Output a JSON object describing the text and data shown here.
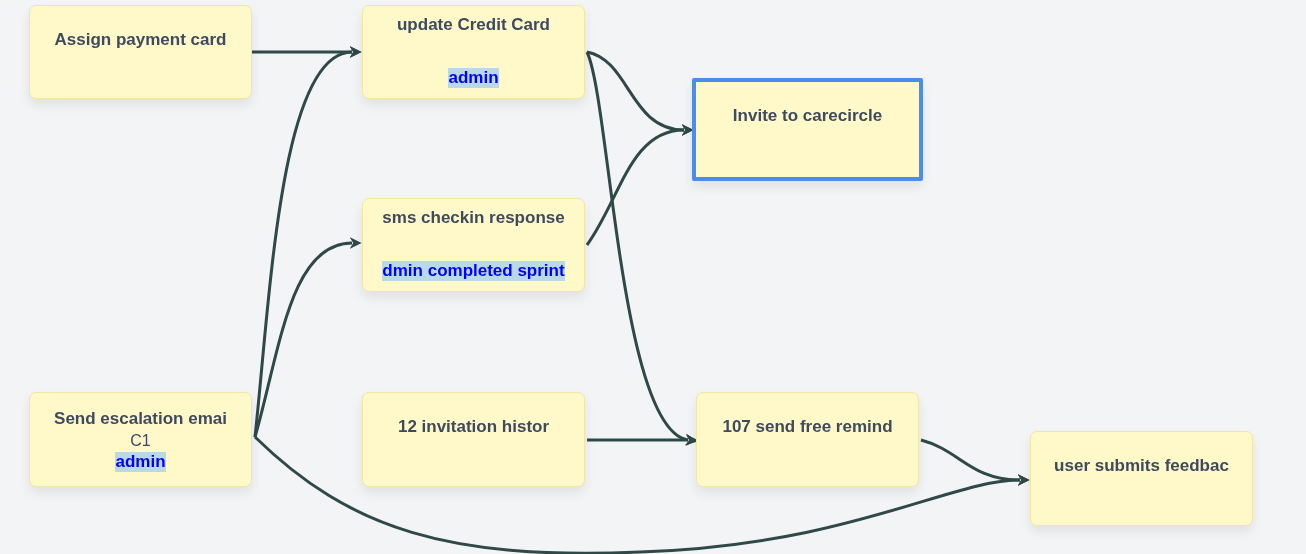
{
  "diagram": {
    "nodes": [
      {
        "title": "Assign payment card",
        "selected": false
      },
      {
        "title": "update Credit Card",
        "tag": "admin",
        "selected": false
      },
      {
        "title": "Invite to carecircle",
        "selected": true
      },
      {
        "title": "sms checkin response",
        "tag": "dmin completed sprint",
        "selected": false
      },
      {
        "title": "Send escalation emai",
        "subtitle": "C1",
        "tag": "admin",
        "selected": false
      },
      {
        "title": "12 invitation histor",
        "selected": false
      },
      {
        "title": "107 send free remind",
        "selected": false
      },
      {
        "title": "user submits feedbac",
        "selected": false
      }
    ]
  }
}
